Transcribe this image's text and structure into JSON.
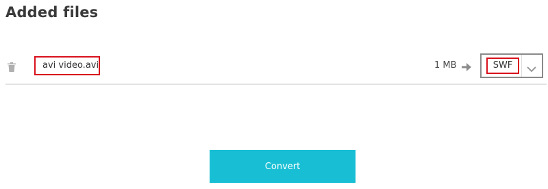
{
  "page": {
    "title": "Added files"
  },
  "files": [
    {
      "name": "avi video.avi",
      "size": "1 MB",
      "target_format": "SWF"
    }
  ],
  "actions": {
    "convert_label": "Convert"
  },
  "icons": {
    "delete": "trash-icon",
    "to": "arrow-right-icon",
    "dropdown": "chevron-down-icon"
  },
  "colors": {
    "accent": "#18bfd4",
    "highlight": "#d9101c",
    "divider": "#e3e3e3"
  }
}
